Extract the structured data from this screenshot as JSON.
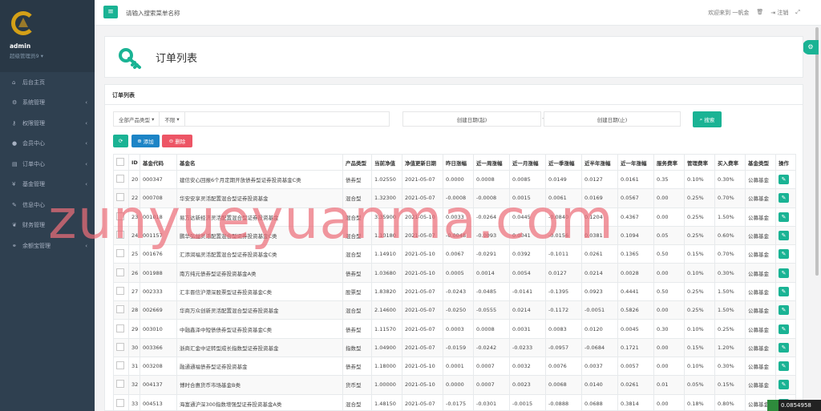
{
  "sidebar": {
    "user": "admin",
    "role": "超级管理员9",
    "items": [
      {
        "icon": "home-icon",
        "glyph": "⌂",
        "label": "后台主页",
        "arrow": ""
      },
      {
        "icon": "gears-icon",
        "glyph": "⚙",
        "label": "系统管理",
        "arrow": "‹"
      },
      {
        "icon": "key-icon",
        "glyph": "⚷",
        "label": "权限管理",
        "arrow": "‹"
      },
      {
        "icon": "user-icon",
        "glyph": "●",
        "label": "会员中心",
        "arrow": "‹"
      },
      {
        "icon": "list-icon",
        "glyph": "▤",
        "label": "订单中心",
        "arrow": "‹"
      },
      {
        "icon": "yen-icon",
        "glyph": "¥",
        "label": "基金管理",
        "arrow": "‹"
      },
      {
        "icon": "wrench-icon",
        "glyph": "✎",
        "label": "信息中心",
        "arrow": ""
      },
      {
        "icon": "leaf-icon",
        "glyph": "❦",
        "label": "财务管理",
        "arrow": ""
      },
      {
        "icon": "network-icon",
        "glyph": "⚭",
        "label": "余额宝管理",
        "arrow": "‹"
      }
    ]
  },
  "topbar": {
    "search_placeholder": "请输入搜索菜单名称",
    "welcome": "欢迎来到 一帆金",
    "lock": "🗑",
    "logout": "注销",
    "fullscreen": "⤢"
  },
  "header": {
    "title": "订单列表"
  },
  "panel": {
    "title": "订单列表",
    "filter_type": "全部产品类型",
    "filter_limit": "不限",
    "date_start": "创建日期(起)",
    "date_end": "创建日期(止)",
    "search_label": "搜索",
    "add_label": "添加",
    "delete_label": "删除"
  },
  "table": {
    "headers": [
      "ID",
      "基金代码",
      "基金名",
      "产品类型",
      "当前净值",
      "净值更新日期",
      "昨日涨幅",
      "近一周涨幅",
      "近一月涨幅",
      "近一季涨幅",
      "近半年涨幅",
      "近一年涨幅",
      "服务费率",
      "管理费率",
      "买入费率",
      "基金类型",
      "操作"
    ],
    "rows": [
      [
        "20",
        "000347",
        "建信安心回报6个月定期开放债券型证券投资基金C类",
        "债券型",
        "1.02550",
        "2021-05-07",
        "0.0000",
        "0.0008",
        "0.0085",
        "0.0149",
        "0.0127",
        "0.0161",
        "0.35",
        "0.10%",
        "0.30%",
        "公募基金"
      ],
      [
        "22",
        "000708",
        "华安安享灵活配置混合型证券投资基金",
        "混合型",
        "1.32300",
        "2021-05-07",
        "-0.0008",
        "-0.0008",
        "0.0015",
        "0.0061",
        "0.0169",
        "0.0567",
        "0.00",
        "0.25%",
        "0.70%",
        "公募基金"
      ],
      [
        "23",
        "001018",
        "易方达新经济灵活配置混合型证券投资基金",
        "混合型",
        "3.35900",
        "2021-05-10",
        "0.0033",
        "-0.0264",
        "0.0445",
        "-0.0840",
        "0.1204",
        "0.4367",
        "0.00",
        "0.25%",
        "1.50%",
        "公募基金"
      ],
      [
        "24",
        "001157",
        "鹏华弘益灵活配置混合型证券投资基金C类",
        "混合型",
        "1.10180",
        "2021-05-07",
        "-0.0048",
        "-0.0093",
        "0.0041",
        "-0.0156",
        "0.0381",
        "0.1094",
        "0.05",
        "0.25%",
        "0.60%",
        "公募基金"
      ],
      [
        "25",
        "001676",
        "汇添润福灵活配置混合型证券投资基金C类",
        "混合型",
        "1.14910",
        "2021-05-10",
        "0.0067",
        "-0.0291",
        "0.0392",
        "-0.1011",
        "0.0261",
        "0.1365",
        "0.50",
        "0.15%",
        "0.70%",
        "公募基金"
      ],
      [
        "26",
        "001988",
        "南方纯元债券型证券投资基金A类",
        "债券型",
        "1.03680",
        "2021-05-10",
        "0.0005",
        "0.0014",
        "0.0054",
        "0.0127",
        "0.0214",
        "0.0028",
        "0.00",
        "0.10%",
        "0.30%",
        "公募基金"
      ],
      [
        "27",
        "002333",
        "汇丰晋信沪港深股票型证券投资基金C类",
        "股票型",
        "1.83820",
        "2021-05-07",
        "-0.0243",
        "-0.0485",
        "-0.0141",
        "-0.1395",
        "0.0923",
        "0.4441",
        "0.50",
        "0.25%",
        "1.50%",
        "公募基金"
      ],
      [
        "28",
        "002669",
        "华商万众创新灵活配置混合型证券投资基金",
        "混合型",
        "2.14600",
        "2021-05-07",
        "-0.0250",
        "-0.0555",
        "0.0214",
        "-0.1172",
        "-0.0051",
        "0.5826",
        "0.00",
        "0.25%",
        "1.50%",
        "公募基金"
      ],
      [
        "29",
        "003010",
        "中融鑫泽中短债债券型证券投资基金C类",
        "债券型",
        "1.11570",
        "2021-05-07",
        "0.0003",
        "0.0008",
        "0.0031",
        "0.0083",
        "0.0120",
        "0.0045",
        "0.30",
        "0.10%",
        "0.25%",
        "公募基金"
      ],
      [
        "30",
        "003366",
        "浙商汇金中证转型成长指数型证券投资基金",
        "指数型",
        "1.04900",
        "2021-05-07",
        "-0.0159",
        "-0.0242",
        "-0.0233",
        "-0.0957",
        "-0.0684",
        "0.1721",
        "0.00",
        "0.15%",
        "1.20%",
        "公募基金"
      ],
      [
        "31",
        "003208",
        "融通通福债券型证券投资基金",
        "债券型",
        "1.18000",
        "2021-05-10",
        "0.0001",
        "0.0007",
        "0.0032",
        "0.0076",
        "0.0037",
        "0.0057",
        "0.00",
        "0.10%",
        "0.30%",
        "公募基金"
      ],
      [
        "32",
        "004137",
        "博时合惠货币市场基金B类",
        "货币型",
        "1.00000",
        "2021-05-10",
        "0.0000",
        "0.0007",
        "0.0023",
        "0.0068",
        "0.0140",
        "0.0261",
        "0.01",
        "0.05%",
        "0.15%",
        "公募基金"
      ],
      [
        "33",
        "004513",
        "海富通沪深300指数增强型证券投资基金A类",
        "混合型",
        "1.48150",
        "2021-05-07",
        "-0.0175",
        "-0.0301",
        "-0.0015",
        "-0.0888",
        "0.0688",
        "0.3814",
        "0.00",
        "0.18%",
        "0.80%",
        "公募基金"
      ]
    ]
  },
  "watermark": "zunyueyuanma.com",
  "fps": "0.0854958",
  "colors": {
    "primary": "#1ab394",
    "info": "#1c84c6",
    "danger": "#ed5565",
    "sidebar": "#2f4050"
  }
}
